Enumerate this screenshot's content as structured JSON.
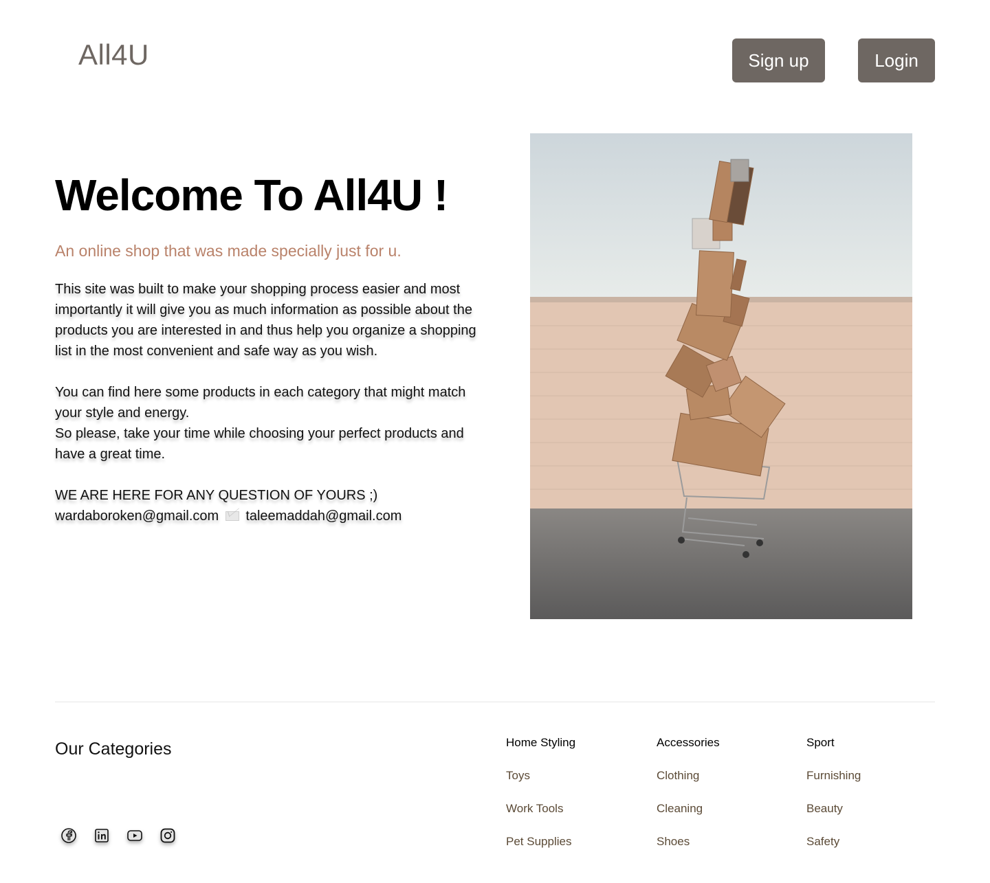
{
  "header": {
    "logo": "All4U",
    "signup_label": "Sign up",
    "login_label": "Login"
  },
  "hero": {
    "title": "Welcome To All4U !",
    "subtitle": "An online shop that was made specially just for u.",
    "paragraph1": "This site was built to make your shopping process easier and most importantly it will give you as much information as possible about the products you are interested in and thus help you organize a shopping list in the most convenient and safe way as you wish.",
    "paragraph2_line1": "You can find here some products in each category that might match your style and energy.",
    "paragraph2_line2": "So please, take your time while choosing your perfect products and have a great time.",
    "contact_heading": "WE ARE HERE FOR ANY QUESTION OF YOURS ;)",
    "email1": "wardaboroken@gmail.com",
    "email2": "taleemaddah@gmail.com",
    "image_icon": "boxes-stacked-on-shopping-cart-photo"
  },
  "footer": {
    "title": "Our Categories",
    "social_icons": [
      "facebook-icon",
      "linkedin-icon",
      "youtube-icon",
      "instagram-icon"
    ],
    "columns": [
      {
        "heading": "Home Styling",
        "links": [
          "Toys",
          "Work Tools",
          "Pet Supplies"
        ]
      },
      {
        "heading": "Accessories",
        "links": [
          "Clothing",
          "Cleaning",
          "Shoes"
        ]
      },
      {
        "heading": "Sport",
        "links": [
          "Furnishing",
          "Beauty",
          "Safety"
        ]
      }
    ]
  },
  "colors": {
    "brand_gray": "#6e6762",
    "subtitle": "#b9826a",
    "link": "#5b4a36"
  }
}
